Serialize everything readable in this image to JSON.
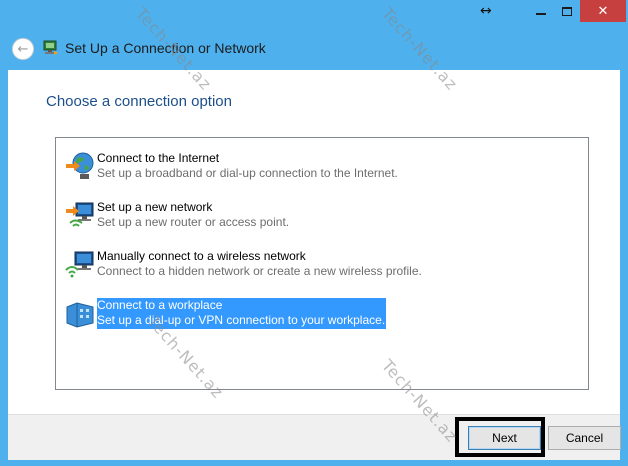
{
  "window": {
    "title": "Set Up a Connection or Network",
    "controls": [
      "minimize",
      "maximize",
      "close"
    ],
    "close_glyph": "✕",
    "resize_glyph": "↔"
  },
  "header": {
    "back_glyph": "←",
    "icon": "network-setup-icon"
  },
  "main": {
    "heading": "Choose a connection option",
    "options": [
      {
        "title": "Connect to the Internet",
        "description": "Set up a broadband or dial-up connection to the Internet.",
        "icon": "globe-icon",
        "selected": false
      },
      {
        "title": "Set up a new network",
        "description": "Set up a new router or access point.",
        "icon": "router-icon",
        "selected": false
      },
      {
        "title": "Manually connect to a wireless network",
        "description": "Connect to a hidden network or create a new wireless profile.",
        "icon": "wireless-icon",
        "selected": false
      },
      {
        "title": "Connect to a workplace",
        "description": "Set up a dial-up or VPN connection to your workplace.",
        "icon": "workplace-icon",
        "selected": true
      }
    ]
  },
  "footer": {
    "next_label": "Next",
    "cancel_label": "Cancel"
  },
  "watermark": "Tech-Net.az",
  "colors": {
    "frame": "#4eb1ee",
    "heading": "#1d4f8b",
    "selection": "#3399ff",
    "close_button": "#c74040"
  }
}
